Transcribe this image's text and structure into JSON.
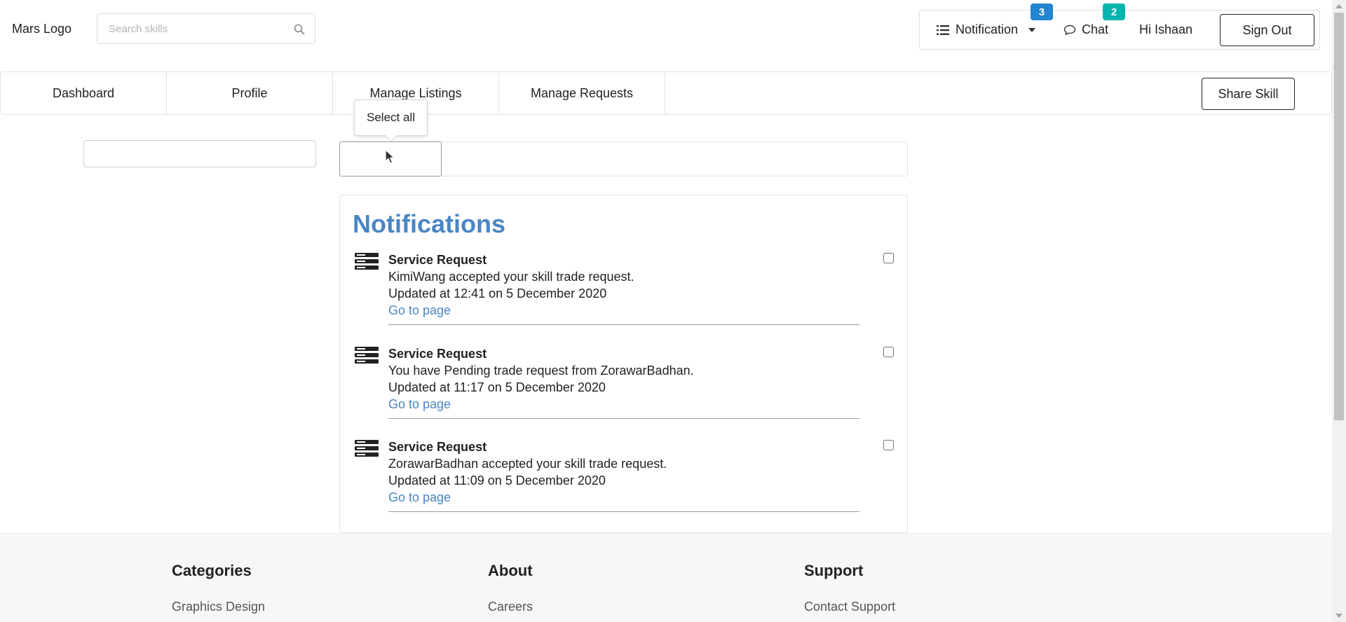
{
  "header": {
    "logo": "Mars Logo",
    "search_placeholder": "Search skills",
    "search_value": "",
    "notification": {
      "label": "Notification",
      "count": "3",
      "badge_color": "#2185d0"
    },
    "chat": {
      "label": "Chat",
      "count": "2",
      "badge_color": "#00b5ad"
    },
    "greeting": "Hi Ishaan",
    "sign_out": "Sign Out"
  },
  "nav": {
    "tabs": [
      {
        "label": "Dashboard"
      },
      {
        "label": "Profile"
      },
      {
        "label": "Manage Listings"
      },
      {
        "label": "Manage Requests"
      }
    ],
    "share_skill": "Share Skill"
  },
  "tooltip": "Select all",
  "panel": {
    "title": "Notifications",
    "title_color": "#4a86c5",
    "items": [
      {
        "title": "Service Request",
        "message": "KimiWang accepted your skill trade request.",
        "time": "Updated at 12:41 on 5 December 2020",
        "link": "Go to page",
        "checked": false
      },
      {
        "title": "Service Request",
        "message": "You have Pending trade request from ZorawarBadhan.",
        "time": "Updated at 11:17 on 5 December 2020",
        "link": "Go to page",
        "checked": false
      },
      {
        "title": "Service Request",
        "message": "ZorawarBadhan accepted your skill trade request.",
        "time": "Updated at 11:09 on 5 December 2020",
        "link": "Go to page",
        "checked": false
      }
    ]
  },
  "footer": {
    "columns": [
      {
        "heading": "Categories",
        "first_link": "Graphics Design"
      },
      {
        "heading": "About",
        "first_link": "Careers"
      },
      {
        "heading": "Support",
        "first_link": "Contact Support"
      }
    ]
  }
}
